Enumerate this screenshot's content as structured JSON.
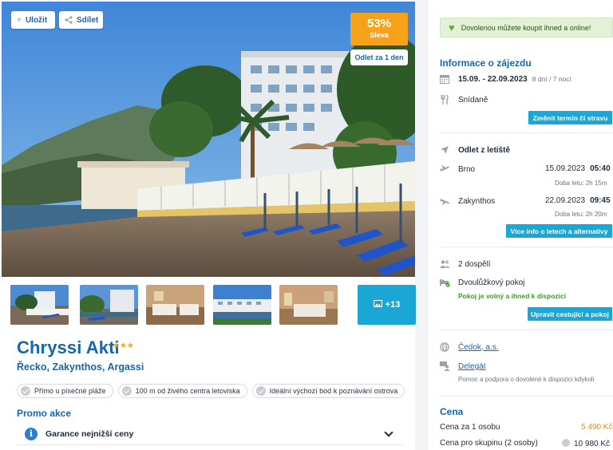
{
  "hero": {
    "save_label": "Uložit",
    "share_label": "Sdílet",
    "discount_pct": "53%",
    "discount_label": "Sleva",
    "departure_label": "Odlet za 1 den"
  },
  "gallery": {
    "more_label": "+13"
  },
  "hotel": {
    "name": "Chryssi Akti",
    "stars": "★★★",
    "location": "Řecko, Zakynthos, Argassi",
    "tags": [
      "Přímo u písečné pláže",
      "100 m od živého centra letoviska",
      "Ideální výchozí bod k poznávání ostrova"
    ]
  },
  "promo": {
    "title": "Promo akce",
    "item": "Garance nejnižší ceny"
  },
  "sidebar": {
    "online_banner": "Dovolenou můžete koupit ihned a online!",
    "trip_title": "Informace o zájezdu",
    "dates": "15.09. - 22.09.2023",
    "duration": "8 dní / 7 nocí",
    "board": "Snídaně",
    "change_term_button": "Změnit termín či stravu",
    "departure_title": "Odlet z letiště",
    "flights": [
      {
        "city": "Brno",
        "date": "15.09.2023",
        "time": "05:40",
        "duration": "Doba letu: 2h 15m"
      },
      {
        "city": "Zakynthos",
        "date": "22.09.2023",
        "time": "09:45",
        "duration": "Doba letu: 2h 20m"
      }
    ],
    "flights_button": "Více info o letech a alternativy",
    "travellers": "2 dospělí",
    "room": "Dvoulůžkový pokoj",
    "room_status": "Pokoj je volný a ihned k dispozici",
    "edit_travellers_button": "Upravit cestující a pokoj",
    "agency": "Čedok, a.s.",
    "delegate_label": "Delegát",
    "delegate_desc": "Pomoc a podpora o dovolené k dispozici kdykoli",
    "price_title": "Cena",
    "price_person_label": "Cena za 1 osobu",
    "price_person_value": "5 490 Kč",
    "price_group_label": "Cena pro skupinu (2 osoby)",
    "price_group_value": "10 980 Kč"
  },
  "colors": {
    "brand_blue": "#1565b3",
    "accent_cyan": "#1aa7d6",
    "discount_orange": "#f7a21b",
    "available_green": "#3c9c1e"
  }
}
